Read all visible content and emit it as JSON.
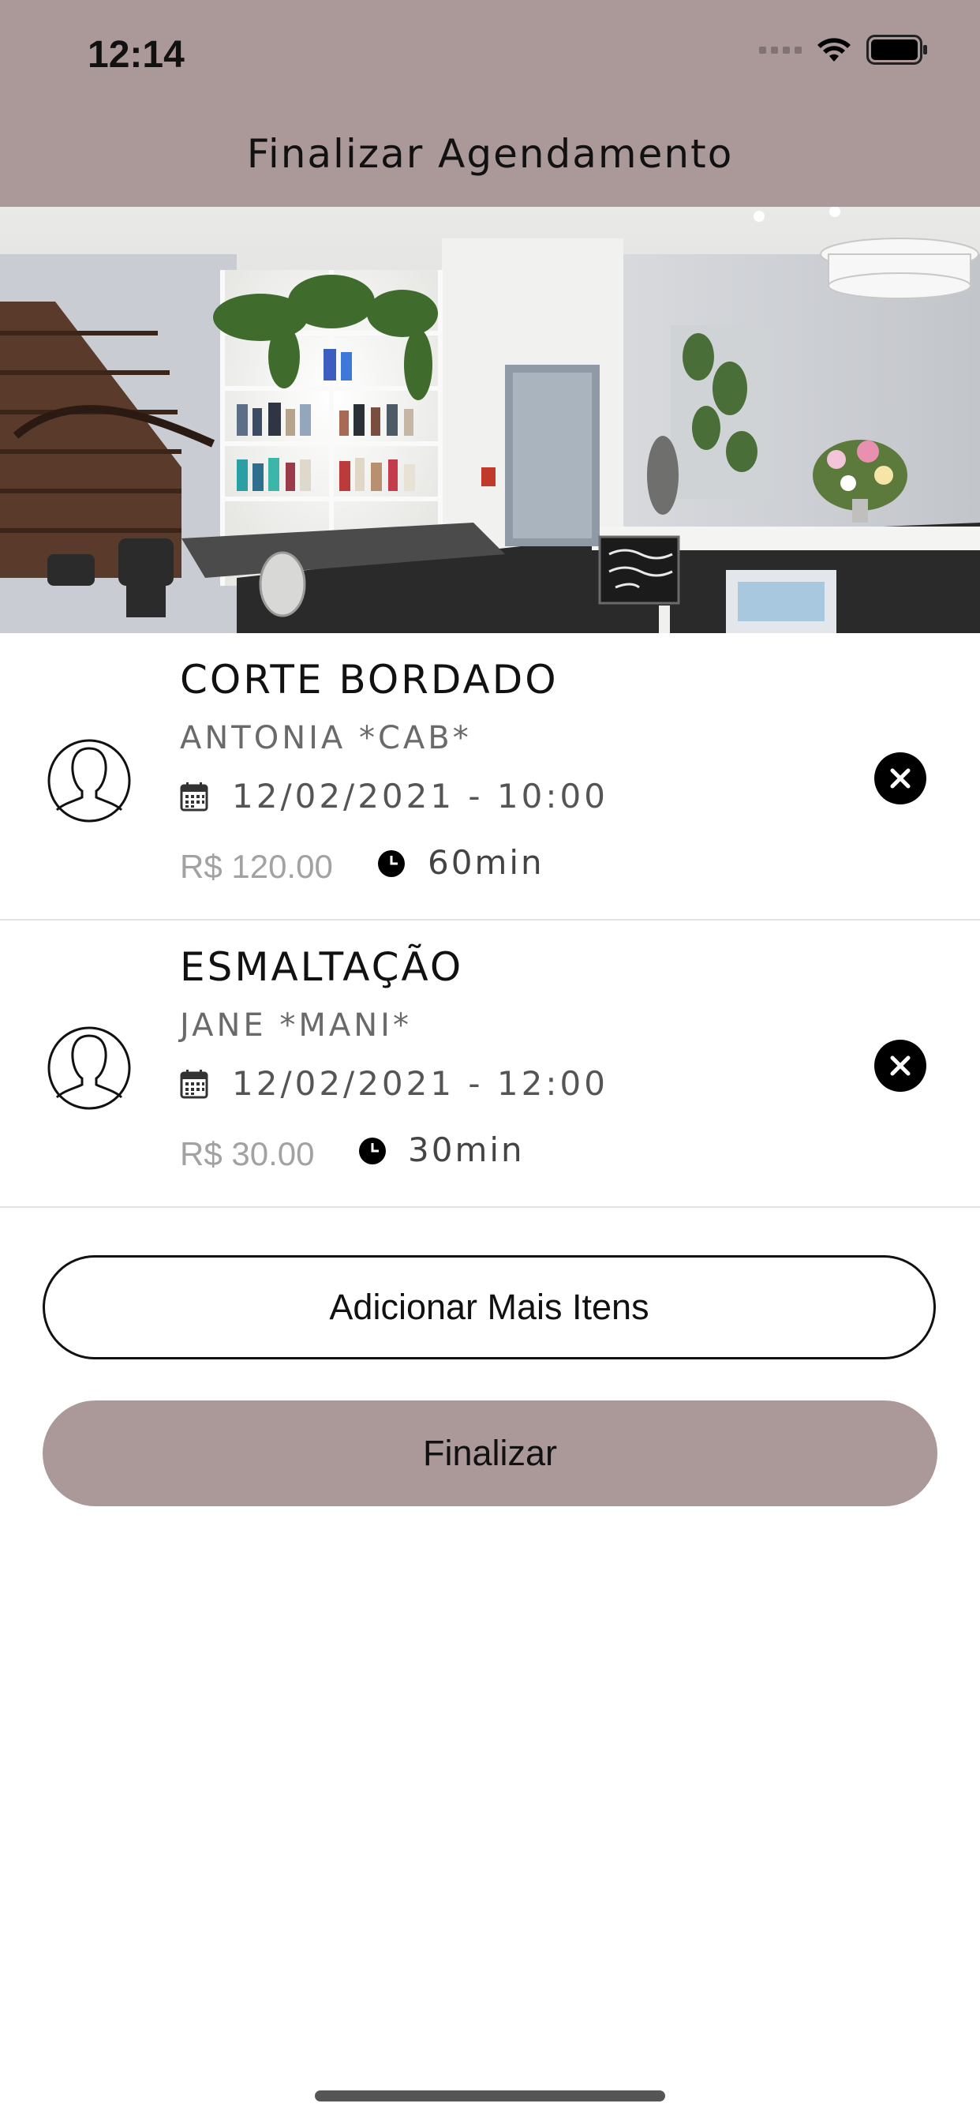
{
  "status_bar": {
    "time": "12:14"
  },
  "header": {
    "title": "Finalizar Agendamento"
  },
  "items": [
    {
      "service": "CORTE BORDADO",
      "professional": "ANTONIA *CAB*",
      "datetime": "12/02/2021 - 10:00",
      "price": "R$ 120.00",
      "duration": "60min"
    },
    {
      "service": "ESMALTAÇÃO",
      "professional": "JANE *MANI*",
      "datetime": "12/02/2021 - 12:00",
      "price": "R$ 30.00",
      "duration": "30min"
    }
  ],
  "actions": {
    "add_more_label": "Adicionar Mais Itens",
    "finish_label": "Finalizar"
  },
  "icons": {
    "avatar": "user-silhouette-icon",
    "calendar": "calendar-icon",
    "clock": "clock-icon",
    "remove": "close-circle-icon",
    "wifi": "wifi-icon",
    "battery": "battery-icon",
    "signal": "signal-icon"
  },
  "colors": {
    "accent": "#ab999a",
    "remove_button": "#000000"
  }
}
